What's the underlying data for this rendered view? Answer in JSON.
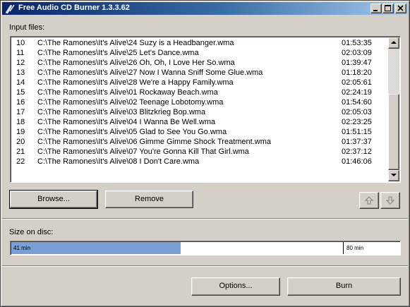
{
  "window": {
    "title": "Free Audio CD Burner 1.3.3.62"
  },
  "title_buttons": [
    "minimize-icon",
    "maximize-icon",
    "close-icon"
  ],
  "input_files": {
    "label": "Input files:",
    "rows": [
      {
        "num": "10",
        "path": "C:\\The Ramones\\It's Alive\\24 Suzy is a Headbanger.wma",
        "duration": "01:53:35"
      },
      {
        "num": "11",
        "path": "C:\\The Ramones\\It's Alive\\25 Let's Dance.wma",
        "duration": "02:03:09"
      },
      {
        "num": "12",
        "path": "C:\\The Ramones\\It's Alive\\26 Oh, Oh, I Love Her So.wma",
        "duration": "01:39:47"
      },
      {
        "num": "13",
        "path": "C:\\The Ramones\\It's Alive\\27 Now I Wanna Sniff Some Glue.wma",
        "duration": "01:18:20"
      },
      {
        "num": "14",
        "path": "C:\\The Ramones\\It's Alive\\28 We're a Happy Family.wma",
        "duration": "02:05:61"
      },
      {
        "num": "15",
        "path": "C:\\The Ramones\\It's Alive\\01 Rockaway Beach.wma",
        "duration": "02:24:19"
      },
      {
        "num": "16",
        "path": "C:\\The Ramones\\It's Alive\\02 Teenage Lobotomy.wma",
        "duration": "01:54:60"
      },
      {
        "num": "17",
        "path": "C:\\The Ramones\\It's Alive\\03 Blitzkrieg Bop.wma",
        "duration": "02:05:03"
      },
      {
        "num": "18",
        "path": "C:\\The Ramones\\It's Alive\\04 I Wanna Be Well.wma",
        "duration": "02:23:25"
      },
      {
        "num": "19",
        "path": "C:\\The Ramones\\It's Alive\\05 Glad to See You Go.wma",
        "duration": "01:51:15"
      },
      {
        "num": "20",
        "path": "C:\\The Ramones\\It's Alive\\06 Gimme Gimme Shock Treatment.wma",
        "duration": "01:37:37"
      },
      {
        "num": "21",
        "path": "C:\\The Ramones\\It's Alive\\07 You're Gonna Kill That Girl.wma",
        "duration": "02:37:12"
      },
      {
        "num": "22",
        "path": "C:\\The Ramones\\It's Alive\\08 I Don't Care.wma",
        "duration": "01:46:06"
      }
    ]
  },
  "buttons": {
    "browse": "Browse...",
    "remove": "Remove",
    "move_up_icon": "arrow-up-icon",
    "move_down_icon": "arrow-down-icon",
    "options": "Options...",
    "burn": "Burn"
  },
  "size_on_disc": {
    "label": "Size on disc:",
    "used_label": "41 min",
    "capacity_label": "80 min",
    "used_fraction": 0.435,
    "fill_color": "#7a9fd4"
  }
}
